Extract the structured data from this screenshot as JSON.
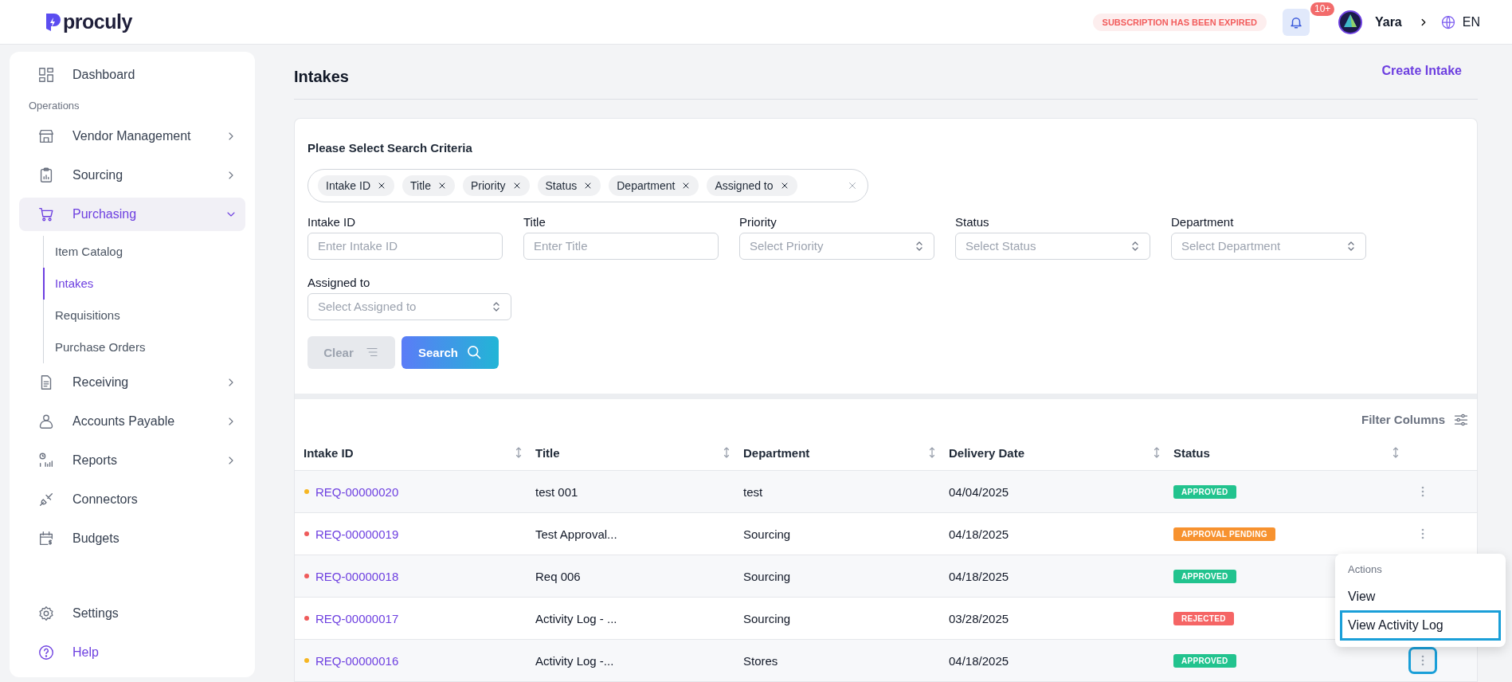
{
  "header": {
    "logo": "proculy",
    "subscription_notice": "SUBSCRIPTION HAS BEEN EXPIRED",
    "notification_count": "10+",
    "user_name": "Yara",
    "language": "EN"
  },
  "sidebar": {
    "items": [
      {
        "kind": "link",
        "label": "Dashboard",
        "selected": false
      },
      {
        "kind": "section",
        "label": "Operations"
      },
      {
        "kind": "group",
        "label": "Vendor Management",
        "selected": false,
        "expanded": false
      },
      {
        "kind": "group",
        "label": "Sourcing",
        "selected": false,
        "expanded": false
      },
      {
        "kind": "group",
        "label": "Purchasing",
        "selected": true,
        "expanded": true,
        "children": [
          {
            "label": "Item Catalog",
            "selected": false
          },
          {
            "label": "Intakes",
            "selected": true
          },
          {
            "label": "Requisitions",
            "selected": false
          },
          {
            "label": "Purchase Orders",
            "selected": false
          }
        ]
      },
      {
        "kind": "group",
        "label": "Receiving",
        "selected": false,
        "expanded": false
      },
      {
        "kind": "group",
        "label": "Accounts Payable",
        "selected": false,
        "expanded": false
      },
      {
        "kind": "group",
        "label": "Reports",
        "selected": false,
        "expanded": false
      },
      {
        "kind": "link",
        "label": "Connectors",
        "selected": false
      },
      {
        "kind": "link",
        "label": "Budgets",
        "selected": false
      }
    ],
    "footer_items": [
      {
        "kind": "link",
        "label": "Settings"
      },
      {
        "kind": "help",
        "label": "Help"
      }
    ]
  },
  "page": {
    "title": "Intakes",
    "create_link": "Create Intake"
  },
  "search": {
    "heading": "Please Select Search Criteria",
    "chips": [
      "Intake ID",
      "Title",
      "Priority",
      "Status",
      "Department",
      "Assigned to"
    ],
    "fields": [
      {
        "kind": "text",
        "label": "Intake ID",
        "placeholder": "Enter Intake ID"
      },
      {
        "kind": "text",
        "label": "Title",
        "placeholder": "Enter Title"
      },
      {
        "kind": "select",
        "label": "Priority",
        "placeholder": "Select Priority"
      },
      {
        "kind": "select",
        "label": "Status",
        "placeholder": "Select Status"
      },
      {
        "kind": "select",
        "label": "Department",
        "placeholder": "Select Department"
      },
      {
        "kind": "select",
        "label": "Assigned to",
        "placeholder": "Select Assigned to"
      }
    ],
    "clear_button": {
      "label": "Clear",
      "disabled": true
    },
    "search_button": {
      "label": "Search"
    }
  },
  "table": {
    "filter_columns": "Filter Columns",
    "columns": [
      "Intake ID",
      "Title",
      "Department",
      "Delivery Date",
      "Status"
    ],
    "rows": [
      {
        "intake_id": "REQ-00000020",
        "color": "#f6b623",
        "title": "test 001",
        "department": "test",
        "delivery_date": "04/04/2025",
        "status": {
          "label": "APPROVED",
          "color": "#22c38e"
        },
        "highlighted": false
      },
      {
        "intake_id": "REQ-00000019",
        "color": "#ef5b5b",
        "title": "Test Approval...",
        "department": "Sourcing",
        "delivery_date": "04/18/2025",
        "status": {
          "label": "APPROVAL PENDING",
          "color": "#f7922f"
        },
        "highlighted": false
      },
      {
        "intake_id": "REQ-00000018",
        "color": "#ef5b5b",
        "title": "Req 006",
        "department": "Sourcing",
        "delivery_date": "04/18/2025",
        "status": {
          "label": "APPROVED",
          "color": "#22c38e"
        }
      },
      {
        "intake_id": "REQ-00000017",
        "color": "#ef5b5b",
        "title": "Activity Log - ...",
        "department": "Sourcing",
        "delivery_date": "03/28/2025",
        "status": {
          "label": "REJECTED",
          "color": "#f56565"
        }
      },
      {
        "intake_id": "REQ-00000016",
        "color": "#f6b623",
        "title": "Activity Log -...",
        "department": "Stores",
        "delivery_date": "04/18/2025",
        "status": {
          "label": "APPROVED",
          "color": "#22c38e"
        },
        "highlighted": true
      }
    ]
  },
  "action_menu": {
    "title": "Actions",
    "items": [
      {
        "label": "View",
        "highlighted": false
      },
      {
        "label": "View Activity Log",
        "highlighted": true
      }
    ]
  }
}
